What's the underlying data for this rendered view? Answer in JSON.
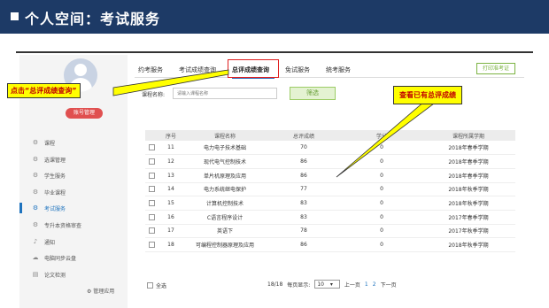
{
  "header": {
    "title": "个人空间：考试服务"
  },
  "sidebar": {
    "account_button": "账号管理",
    "items": [
      {
        "label": "课程",
        "icon": "gear-icon"
      },
      {
        "label": "选课管理",
        "icon": "gear-icon"
      },
      {
        "label": "学生服务",
        "icon": "gear-icon"
      },
      {
        "label": "毕业课程",
        "icon": "gear-icon"
      },
      {
        "label": "考试服务",
        "icon": "gear-icon"
      },
      {
        "label": "专升本资格审查",
        "icon": "gear-icon"
      },
      {
        "label": "通知",
        "icon": "bell-icon"
      },
      {
        "label": "电脑同步云盘",
        "icon": "cloud-icon"
      },
      {
        "label": "论文检测",
        "icon": "document-icon"
      }
    ],
    "active_index": 4,
    "manage_label": "管理应用"
  },
  "tabs": [
    "约考服务",
    "考试成绩查询",
    "总评成绩查询",
    "免试服务",
    "统考服务"
  ],
  "active_tab": 2,
  "print_button": "打印准考证",
  "filter": {
    "label": "课程名称:",
    "placeholder": "请输入课程名称",
    "button": "筛选"
  },
  "table": {
    "headers": [
      "序号",
      "课程名称",
      "总评成绩",
      "学分",
      "课程所属学期"
    ],
    "rows": [
      [
        "11",
        "电力电子技术基础",
        "70",
        "0",
        "2018年春季学期"
      ],
      [
        "12",
        "现代电气控制技术",
        "86",
        "0",
        "2018年春季学期"
      ],
      [
        "13",
        "单片机原理及应用",
        "86",
        "0",
        "2018年春季学期"
      ],
      [
        "14",
        "电力系统继电保护",
        "77",
        "0",
        "2018年秋季学期"
      ],
      [
        "15",
        "计算机控制技术",
        "83",
        "0",
        "2018年秋季学期"
      ],
      [
        "16",
        "C语言程序设计",
        "83",
        "0",
        "2017年春季学期"
      ],
      [
        "17",
        "英语下",
        "78",
        "0",
        "2017年秋季学期"
      ],
      [
        "18",
        "可编程控制器原理及应用",
        "86",
        "0",
        "2018年秋季学期"
      ]
    ]
  },
  "footer": {
    "select_all": "全选",
    "count": "18/18",
    "per_page_label": "每页显示:",
    "per_page": "10",
    "prev": "上一页",
    "page1": "1",
    "page2": "2",
    "next": "下一页"
  },
  "callouts": {
    "left": "点击“总评成绩查询”",
    "right": "查看已有总评成绩"
  },
  "colors": {
    "header_bg": "#1d3a66",
    "active_blue": "#1e73be",
    "callout_bg": "#ffff00",
    "callout_text": "#c00000",
    "highlight_red": "#e02020"
  }
}
